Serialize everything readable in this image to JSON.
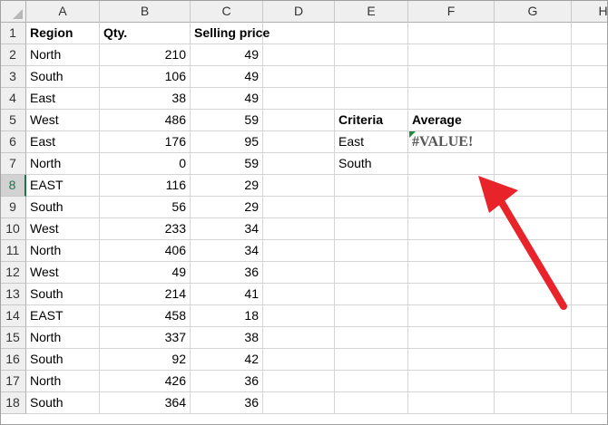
{
  "columns": [
    "A",
    "B",
    "C",
    "D",
    "E",
    "F",
    "G",
    "H"
  ],
  "rows": [
    "1",
    "2",
    "3",
    "4",
    "5",
    "6",
    "7",
    "8",
    "9",
    "10",
    "11",
    "12",
    "13",
    "14",
    "15",
    "16",
    "17",
    "18"
  ],
  "selected_row": "8",
  "table": {
    "headers": [
      "Region",
      "Qty.",
      "Selling price"
    ],
    "data": [
      [
        "North",
        "210",
        "49"
      ],
      [
        "South",
        "106",
        "49"
      ],
      [
        "East",
        "38",
        "49"
      ],
      [
        "West",
        "486",
        "59"
      ],
      [
        "East",
        "176",
        "95"
      ],
      [
        "North",
        "0",
        "59"
      ],
      [
        "EAST",
        "116",
        "29"
      ],
      [
        "South",
        "56",
        "29"
      ],
      [
        "West",
        "233",
        "34"
      ],
      [
        "North",
        "406",
        "34"
      ],
      [
        "West",
        "49",
        "36"
      ],
      [
        "South",
        "214",
        "41"
      ],
      [
        "EAST",
        "458",
        "18"
      ],
      [
        "North",
        "337",
        "38"
      ],
      [
        "South",
        "92",
        "42"
      ],
      [
        "North",
        "426",
        "36"
      ],
      [
        "South",
        "364",
        "36"
      ]
    ]
  },
  "criteria_table": {
    "criteria_header": "Criteria",
    "average_header": "Average",
    "criteria": [
      "East",
      "South"
    ],
    "result": "#VALUE!"
  },
  "annotation": {
    "icon": "red-arrow-icon",
    "color": "#e8232a"
  },
  "colors": {
    "error_indicator": "#1f8a3c",
    "selected_header": "#217346"
  }
}
